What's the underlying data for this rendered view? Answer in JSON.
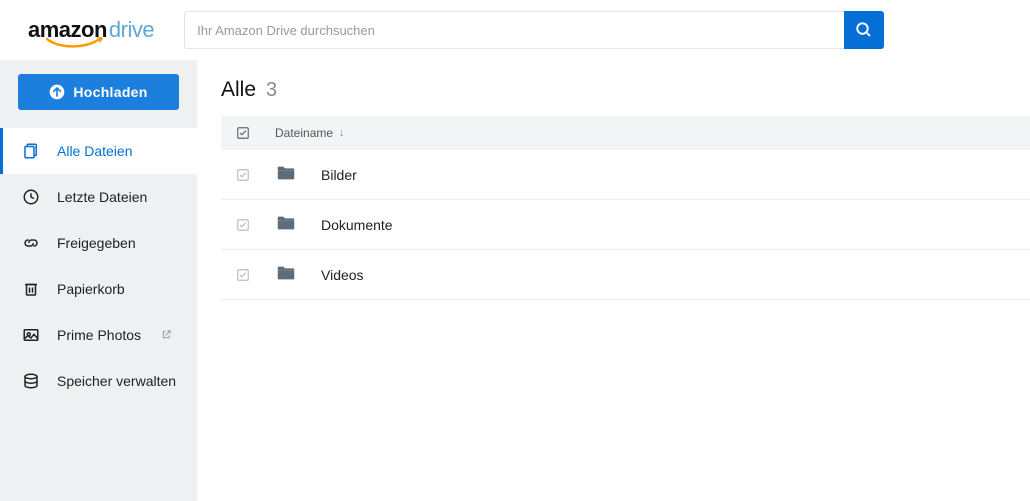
{
  "logo": {
    "amazon": "amazon",
    "drive": "drive"
  },
  "search": {
    "placeholder": "Ihr Amazon Drive durchsuchen"
  },
  "upload_label": "Hochladen",
  "sidebar": {
    "items": [
      {
        "label": "Alle Dateien"
      },
      {
        "label": "Letzte Dateien"
      },
      {
        "label": "Freigegeben"
      },
      {
        "label": "Papierkorb"
      },
      {
        "label": "Prime Photos"
      },
      {
        "label": "Speicher verwalten"
      }
    ]
  },
  "main": {
    "title": "Alle",
    "count": "3",
    "column_name": "Dateiname",
    "rows": [
      {
        "name": "Bilder"
      },
      {
        "name": "Dokumente"
      },
      {
        "name": "Videos"
      }
    ]
  }
}
